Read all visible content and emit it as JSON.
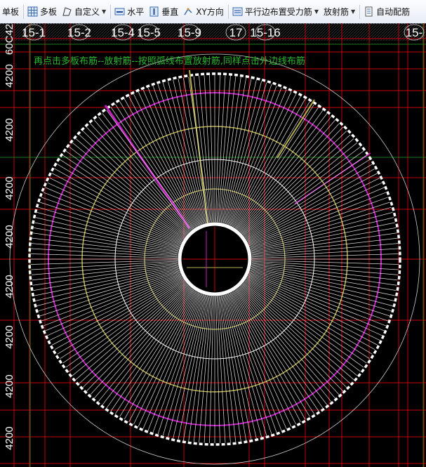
{
  "toolbar": {
    "items": [
      {
        "label": "单板",
        "icon": "",
        "dropdown": false
      },
      {
        "label": "多板",
        "icon": "grid-icon",
        "dropdown": false
      },
      {
        "label": "自定义",
        "icon": "pen-shape-icon",
        "dropdown": true
      },
      {
        "label": "水平",
        "icon": "horizontal-icon",
        "dropdown": false
      },
      {
        "label": "垂直",
        "icon": "vertical-icon",
        "dropdown": false
      },
      {
        "label": "XY方向",
        "icon": "xy-direction-icon",
        "dropdown": false
      },
      {
        "label": "平行边布置受力筋",
        "icon": "parallel-edge-icon",
        "dropdown": true
      },
      {
        "label": "放射筋",
        "icon": "",
        "dropdown": true
      },
      {
        "label": "自动配筋",
        "icon": "auto-rebar-icon",
        "dropdown": false
      }
    ]
  },
  "canvas": {
    "hint": "再点击多板布筋--放射筋--按照弧线布置放射筋,同样点击外边线布筋",
    "top_axis_labels": [
      "15-1",
      "15-2",
      "15-4",
      "15-5",
      "15-9",
      "17",
      "15-16",
      "15-"
    ],
    "left_axis_labels": [
      "60C42",
      "4200",
      "4200",
      "4200",
      "4200",
      "4200",
      "4200",
      "4200",
      "4200"
    ],
    "colors": {
      "background": "#000000",
      "grid_line": "#c4000f",
      "axis_line": "#1f7a1f",
      "radial_rebar": "#ffffff",
      "ring_yellow": "#b8b04a",
      "ring_magenta": "#c020c0",
      "hint_text": "#29b82e",
      "axis_text": "#ffffff"
    }
  }
}
